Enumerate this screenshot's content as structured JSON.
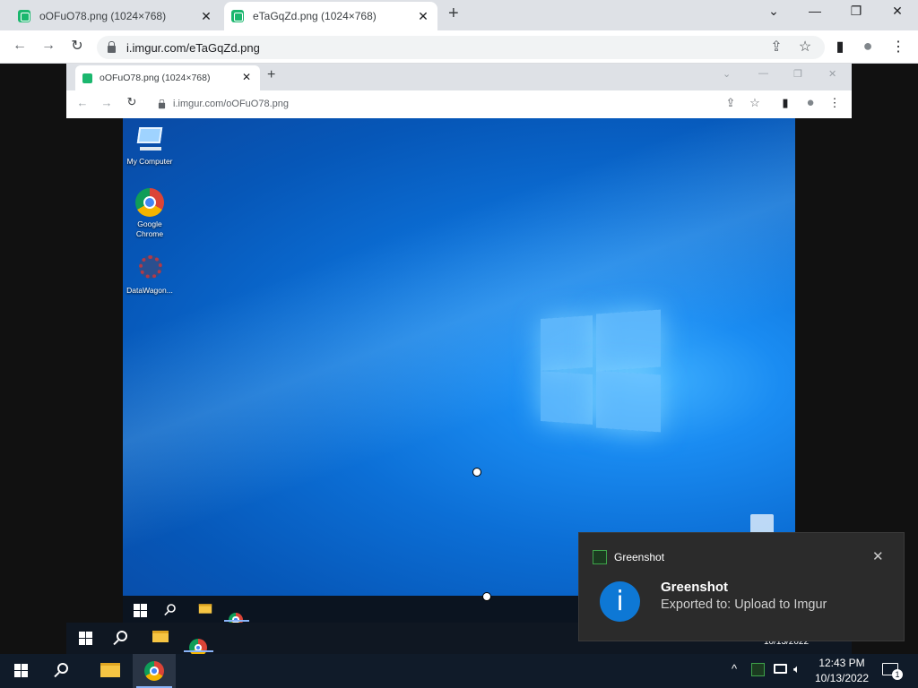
{
  "outer_browser": {
    "tabs": [
      {
        "title": "oOFuO78.png (1024×768)",
        "close": "✕"
      },
      {
        "title": "eTaGqZd.png (1024×768)",
        "close": "✕"
      }
    ],
    "new_tab": "+",
    "window_controls": {
      "tab_search": "⌄",
      "minimize": "—",
      "restore": "❐",
      "close": "✕"
    },
    "nav": {
      "back": "←",
      "forward": "→",
      "reload": "↻"
    },
    "url": "i.imgur.com/eTaGqZd.png",
    "actions": {
      "share": "⇪",
      "bookmark": "☆",
      "sidepanel": "▮",
      "profile": "●",
      "menu": "⋮"
    }
  },
  "inner_browser": {
    "tab": {
      "title": "oOFuO78.png (1024×768)",
      "close": "✕"
    },
    "new_tab": "+",
    "window_controls": {
      "tab_search": "⌄",
      "minimize": "—",
      "restore": "❐",
      "close": "✕"
    },
    "nav": {
      "back": "←",
      "forward": "→",
      "reload": "↻"
    },
    "url": "i.imgur.com/oOFuO78.png",
    "actions": {
      "share": "⇪",
      "bookmark": "☆",
      "sidepanel": "▮",
      "profile": "●",
      "menu": "⋮"
    }
  },
  "desktop": {
    "icons": [
      {
        "label": "My Computer",
        "icon": "computer-icon"
      },
      {
        "label": "Google Chrome",
        "icon": "chrome-icon"
      },
      {
        "label": "DataWagon...",
        "icon": "datawagon-icon"
      }
    ],
    "inner_clock_date": "10/13/2022"
  },
  "toast": {
    "app_name": "Greenshot",
    "close": "✕",
    "info_glyph": "i",
    "title": "Greenshot",
    "message": "Exported to: Upload to Imgur"
  },
  "taskbar": {
    "time": "12:43 PM",
    "date": "10/13/2022",
    "tray": {
      "chevron": "^",
      "volume": "🔈︎",
      "notifications_count": "1"
    }
  },
  "colors": {
    "desktop_blue": "#0c6fd6",
    "taskbar": "#101b29",
    "toast_bg": "#2b2b2b",
    "info_blue": "#0e78d5"
  }
}
